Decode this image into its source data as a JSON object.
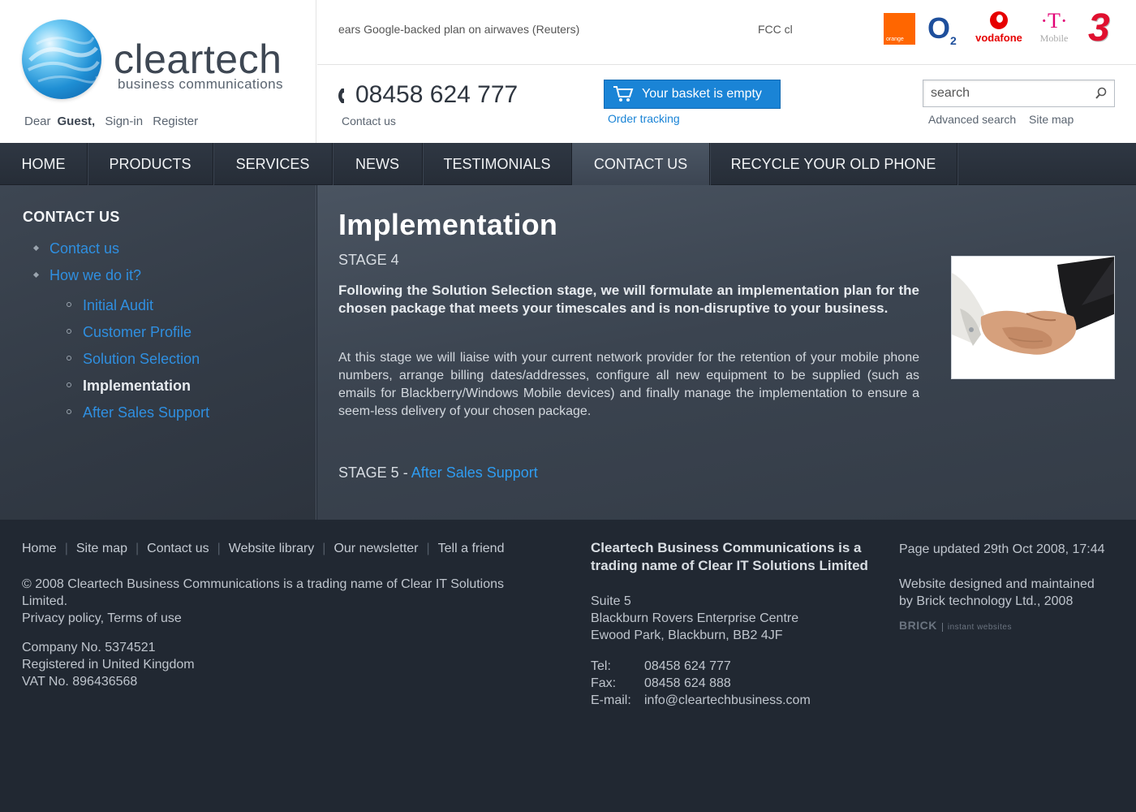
{
  "header": {
    "logo_word": "cleartech",
    "logo_tagline": "business communications",
    "guest_prefix": "Dear",
    "guest_name": "Guest,",
    "sign_in": "Sign-in",
    "register": "Register",
    "ticker_1": "ears Google-backed plan on airwaves (Reuters)",
    "ticker_2": "FCC cl",
    "carriers": {
      "orange": "orange",
      "o2": "O",
      "o2_sub": "2",
      "vodafone": "vodafone",
      "tmobile_t": "·T·",
      "tmobile_word": "Mobile",
      "three": "3"
    },
    "phone": "08458 624 777",
    "contact_us": "Contact us",
    "basket_label": "Your basket is empty",
    "order_tracking": "Order tracking",
    "search_placeholder": "search",
    "advanced_search": "Advanced search",
    "site_map": "Site map"
  },
  "nav": [
    {
      "label": "HOME",
      "active": false
    },
    {
      "label": "PRODUCTS",
      "active": false
    },
    {
      "label": "SERVICES",
      "active": false
    },
    {
      "label": "NEWS",
      "active": false
    },
    {
      "label": "TESTIMONIALS",
      "active": false
    },
    {
      "label": "CONTACT US",
      "active": true
    },
    {
      "label": "RECYCLE YOUR OLD PHONE",
      "active": false
    }
  ],
  "sidebar": {
    "title": "CONTACT US",
    "items": [
      {
        "label": "Contact us",
        "level": 1,
        "current": false
      },
      {
        "label": "How we do it?",
        "level": 1,
        "current": false
      },
      {
        "label": "Initial Audit",
        "level": 2,
        "current": false
      },
      {
        "label": "Customer Profile",
        "level": 2,
        "current": false
      },
      {
        "label": "Solution Selection",
        "level": 2,
        "current": false
      },
      {
        "label": "Implementation",
        "level": 2,
        "current": true
      },
      {
        "label": "After Sales Support",
        "level": 2,
        "current": false
      }
    ]
  },
  "main": {
    "title": "Implementation",
    "stage": "STAGE 4",
    "lead": "Following the Solution Selection stage, we will formulate an implementation plan for the chosen package that meets your timescales and is non-disruptive to your business.",
    "body": "At this stage we will liaise with your current network provider for the retention of your mobile phone numbers, arrange billing dates/addresses, configure all new equipment to be supplied (such as emails for Blackberry/Windows Mobile devices) and finally manage the implementation to ensure a seem-less delivery of your chosen package.",
    "next_stage_prefix": "STAGE 5 - ",
    "next_stage_link": "After Sales Support"
  },
  "footer": {
    "links": [
      "Home",
      "Site map",
      "Contact us",
      "Website library",
      "Our newsletter",
      "Tell a friend"
    ],
    "copyright_1": "© 2008 Cleartech Business Communications is a trading name of Clear IT Solutions",
    "copyright_2": "Limited.",
    "policy": "Privacy policy, Terms of use",
    "company_no": "Company No. 5374521",
    "registered": "Registered in United Kingdom",
    "vat": "VAT No. 896436568",
    "company_heading": "Cleartech Business Communications is a trading name of Clear IT Solutions Limited",
    "address_1": "Suite 5",
    "address_2": "Blackburn Rovers Enterprise Centre",
    "address_3": "Ewood Park, Blackburn, BB2 4JF",
    "tel_label": "Tel:",
    "tel": "08458 624 777",
    "fax_label": "Fax:",
    "fax": "08458 624 888",
    "email_label": "E-mail:",
    "email": "info@cleartechbusiness.com",
    "updated": "Page updated 29th Oct 2008, 17:44",
    "designed_1": "Website designed and maintained",
    "designed_2": "by Brick technology Ltd., 2008",
    "brick": "BRICK",
    "brick_sub": "instant websites"
  }
}
